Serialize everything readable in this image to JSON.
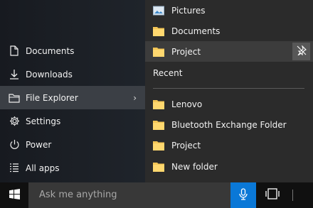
{
  "left_menu": {
    "items": [
      {
        "label": "Documents",
        "icon": "document-icon"
      },
      {
        "label": "Downloads",
        "icon": "download-icon"
      },
      {
        "label": "File Explorer",
        "icon": "file-explorer-icon",
        "chevron": "›"
      },
      {
        "label": "Settings",
        "icon": "gear-icon"
      },
      {
        "label": "Power",
        "icon": "power-icon"
      },
      {
        "label": "All apps",
        "icon": "all-apps-icon"
      }
    ]
  },
  "jump_list": {
    "pinned": [
      {
        "label": "Pictures",
        "icon": "pictures-icon"
      },
      {
        "label": "Documents",
        "icon": "folder-icon"
      },
      {
        "label": "Project",
        "icon": "folder-icon"
      }
    ],
    "recent_title": "Recent",
    "recent": [
      {
        "label": "Lenovo",
        "icon": "folder-icon"
      },
      {
        "label": "Bluetooth Exchange Folder",
        "icon": "folder-icon"
      },
      {
        "label": "Project",
        "icon": "folder-icon"
      },
      {
        "label": "New folder",
        "icon": "folder-icon"
      }
    ]
  },
  "taskbar": {
    "search_placeholder": "Ask me anything",
    "accent_color": "#0a78d7"
  }
}
